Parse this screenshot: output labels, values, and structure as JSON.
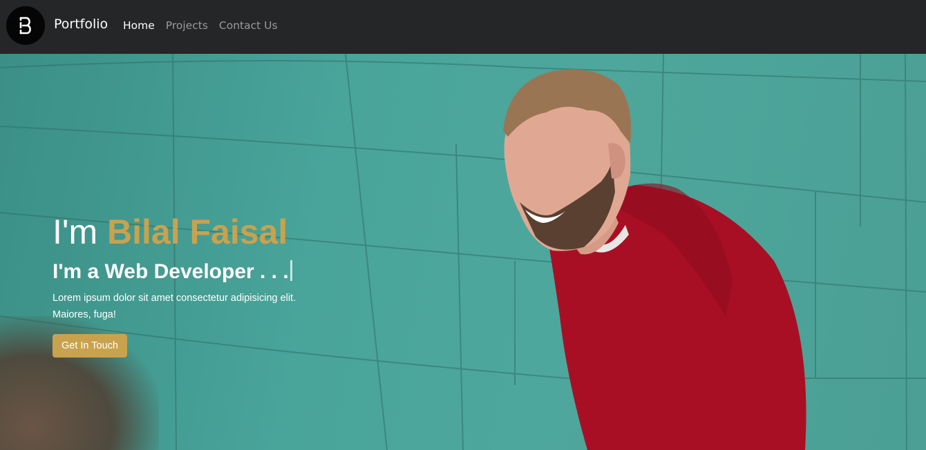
{
  "nav": {
    "brand": "Portfolio",
    "links": [
      {
        "label": "Home",
        "active": true
      },
      {
        "label": "Projects",
        "active": false
      },
      {
        "label": "Contact Us",
        "active": false
      }
    ]
  },
  "hero": {
    "intro_prefix": "I'm",
    "name": "Bilal Faisal",
    "role": "I'm a Web Developer . . .",
    "description": "Lorem ipsum dolor sit amet consectetur adipisicing elit. Maiores, fuga!",
    "cta_label": "Get In Touch"
  },
  "colors": {
    "accent": "#c9a24e",
    "navbar": "#252627",
    "wall": "#4ea79c",
    "sweater": "#a80f24"
  },
  "icons": {
    "logo": "b-logo-icon"
  }
}
